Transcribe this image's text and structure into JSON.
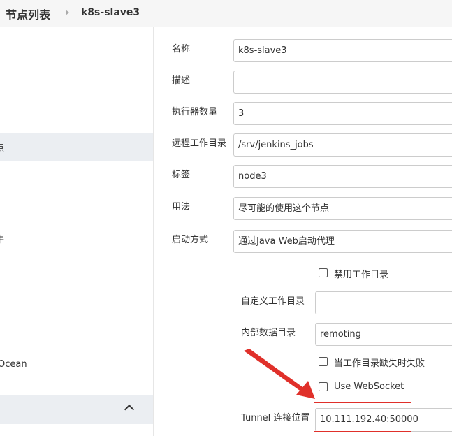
{
  "breadcrumb": {
    "root": "节点列表",
    "current": "k8s-slave3"
  },
  "sidebar": {
    "item_1": "点",
    "item_2": "牛",
    "item_3": "Ocean"
  },
  "form": {
    "name": {
      "label": "名称",
      "value": "k8s-slave3"
    },
    "description": {
      "label": "描述",
      "value": ""
    },
    "executors": {
      "label": "执行器数量",
      "value": "3"
    },
    "remote_dir": {
      "label": "远程工作目录",
      "value": "/srv/jenkins_jobs"
    },
    "labels": {
      "label": "标签",
      "value": "node3"
    },
    "usage": {
      "label": "用法",
      "value": "尽可能的使用这个节点"
    },
    "launch": {
      "label": "启动方式",
      "value": "通过Java Web启动代理"
    },
    "disable_workdir": {
      "label": "禁用工作目录",
      "checked": false
    },
    "custom_workdir": {
      "label": "自定义工作目录",
      "value": ""
    },
    "internal_dir": {
      "label": "内部数据目录",
      "value": "remoting"
    },
    "fail_if_missing": {
      "label": "当工作目录缺失时失败",
      "checked": false
    },
    "use_websocket": {
      "label": "Use WebSocket",
      "checked": false
    },
    "tunnel": {
      "label": "Tunnel 连接位置",
      "value": "10.111.192.40:50000"
    }
  },
  "colors": {
    "annotation": "#e0302a",
    "sidebar_highlight": "#ebeef2"
  }
}
